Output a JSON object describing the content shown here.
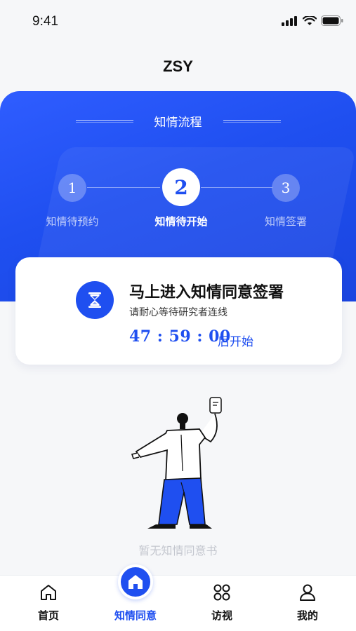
{
  "status_bar": {
    "time": "9:41"
  },
  "header": {
    "title": "ZSY"
  },
  "process": {
    "title": "知情流程",
    "steps": [
      {
        "number": "1",
        "label": "知情待预约",
        "active": false
      },
      {
        "number": "2",
        "label": "知情待开始",
        "active": true
      },
      {
        "number": "3",
        "label": "知情签署",
        "active": false
      }
    ]
  },
  "card": {
    "icon": "hourglass-icon",
    "title": "马上进入知情同意签署",
    "subtitle": "请耐心等待研究者连线",
    "countdown": "47 : 59 : 00",
    "countdown_suffix": "后开始"
  },
  "empty_state": {
    "text": "暂无知情同意书"
  },
  "tabbar": {
    "items": [
      {
        "label": "首页",
        "icon": "home-outline-icon",
        "active": false
      },
      {
        "label": "知情同意",
        "icon": "home-filled-icon",
        "active": true
      },
      {
        "label": "访视",
        "icon": "grid-four-circles-icon",
        "active": false
      },
      {
        "label": "我的",
        "icon": "user-icon",
        "active": false
      }
    ]
  },
  "colors": {
    "primary": "#1f4ff0",
    "background": "#f6f7f9"
  }
}
